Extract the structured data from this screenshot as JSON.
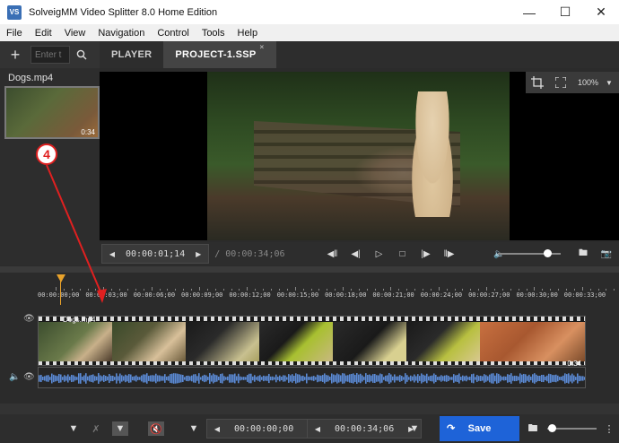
{
  "app": {
    "title": "SolveigMM Video Splitter 8.0 Home Edition",
    "icon_text": "VS",
    "window_controls": [
      "minimize-icon",
      "maximize-icon",
      "close-icon"
    ]
  },
  "menu": [
    "File",
    "Edit",
    "View",
    "Navigation",
    "Control",
    "Tools",
    "Help"
  ],
  "sidebar": {
    "add_label": "+",
    "search_placeholder": "Enter t",
    "file_name": "Dogs.mp4",
    "thumb_duration": "0:34"
  },
  "tabs": [
    {
      "label": "PLAYER",
      "active": false
    },
    {
      "label": "PROJECT-1.SSP",
      "active": true,
      "close": "×"
    }
  ],
  "viewer": {
    "zoom": "100%"
  },
  "player_controls": {
    "current_time": "00:00:01;14",
    "duration": "/ 00:00:34;06",
    "volume_level": 0.8
  },
  "ruler": {
    "ticks": [
      "00:00:00;00",
      "00:00:03;00",
      "00:00:06;00",
      "00:00:09;00",
      "00:00:12;00",
      "00:00:15;00",
      "00:00:18;00",
      "00:00:21;00",
      "00:00:24;00",
      "00:00:27;00",
      "00:00:30;00",
      "00:00:33;00"
    ]
  },
  "timeline": {
    "clip_name": "Dogs.mp4",
    "clip_end": "0:34"
  },
  "bottom": {
    "start_time": "00:00:00;00",
    "end_time": "00:00:34;06",
    "save_label": "Save"
  },
  "annotation": {
    "number": "4",
    "color": "#e02020"
  },
  "colors": {
    "accent": "#1e63d8",
    "cursor": "#e8a22b",
    "waveform": "#5b8bd6"
  }
}
